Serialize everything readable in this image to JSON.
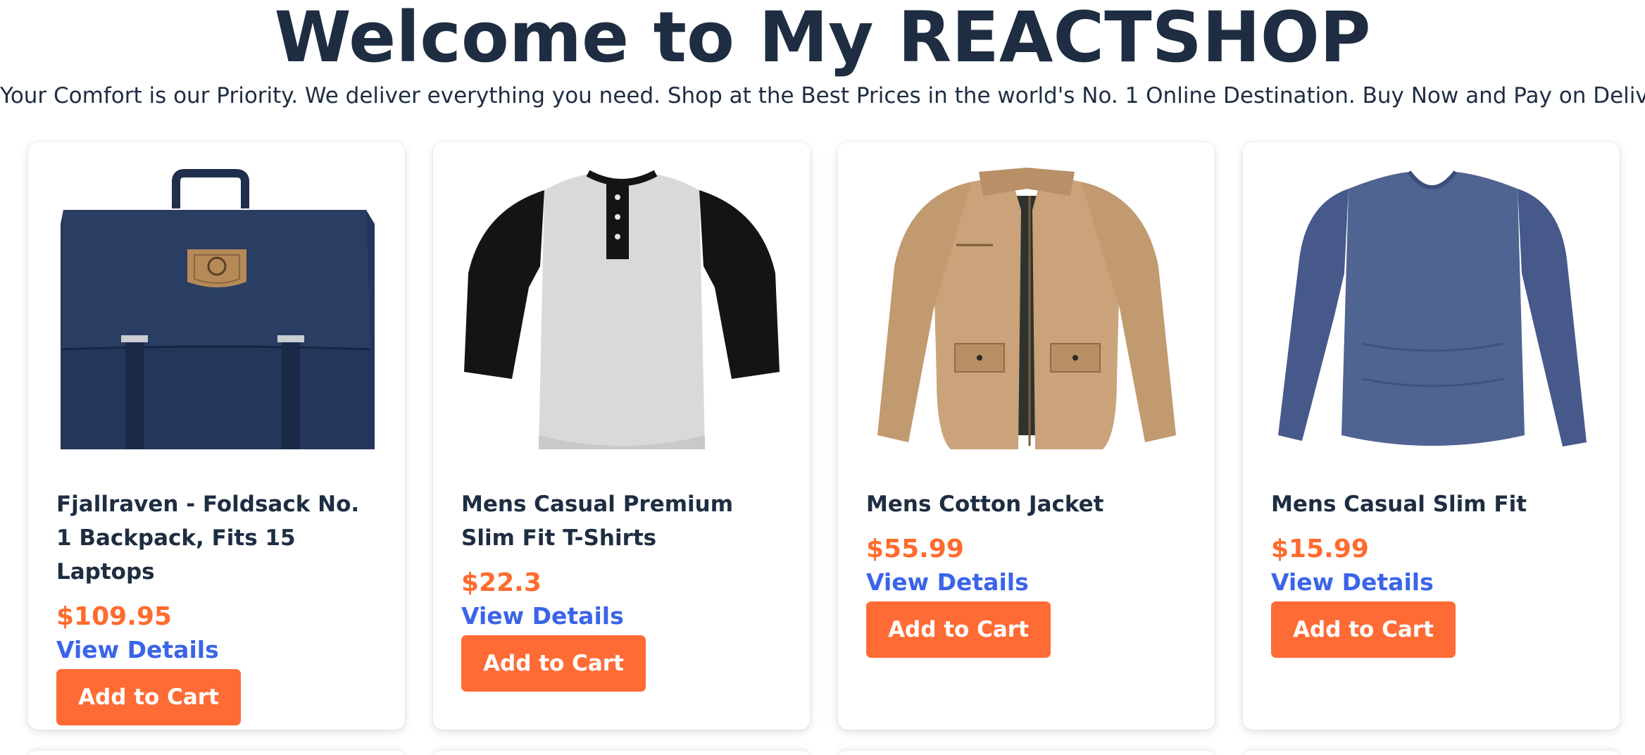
{
  "hero": {
    "title": "Welcome to My REACTSHOP",
    "subtitle": "Your Comfort is our Priority. We deliver everything you need. Shop at the Best Prices in the world's No. 1 Online Destination. Buy Now and Pay on Delivery."
  },
  "colors": {
    "heading": "#1e2d42",
    "price": "#ff6b2e",
    "link": "#3b64e8",
    "button": "#ff6b35"
  },
  "products": [
    {
      "title": "Fjallraven - Foldsack No. 1 Backpack, Fits 15 Laptops",
      "price": "$109.95",
      "details_label": "View Details",
      "cart_label": "Add to Cart",
      "image_icon": "backpack-image"
    },
    {
      "title": "Mens Casual Premium Slim Fit T-Shirts",
      "price": "$22.3",
      "details_label": "View Details",
      "cart_label": "Add to Cart",
      "image_icon": "tshirt-image"
    },
    {
      "title": "Mens Cotton Jacket",
      "price": "$55.99",
      "details_label": "View Details",
      "cart_label": "Add to Cart",
      "image_icon": "jacket-image"
    },
    {
      "title": "Mens Casual Slim Fit",
      "price": "$15.99",
      "details_label": "View Details",
      "cart_label": "Add to Cart",
      "image_icon": "longsleeve-image"
    }
  ]
}
